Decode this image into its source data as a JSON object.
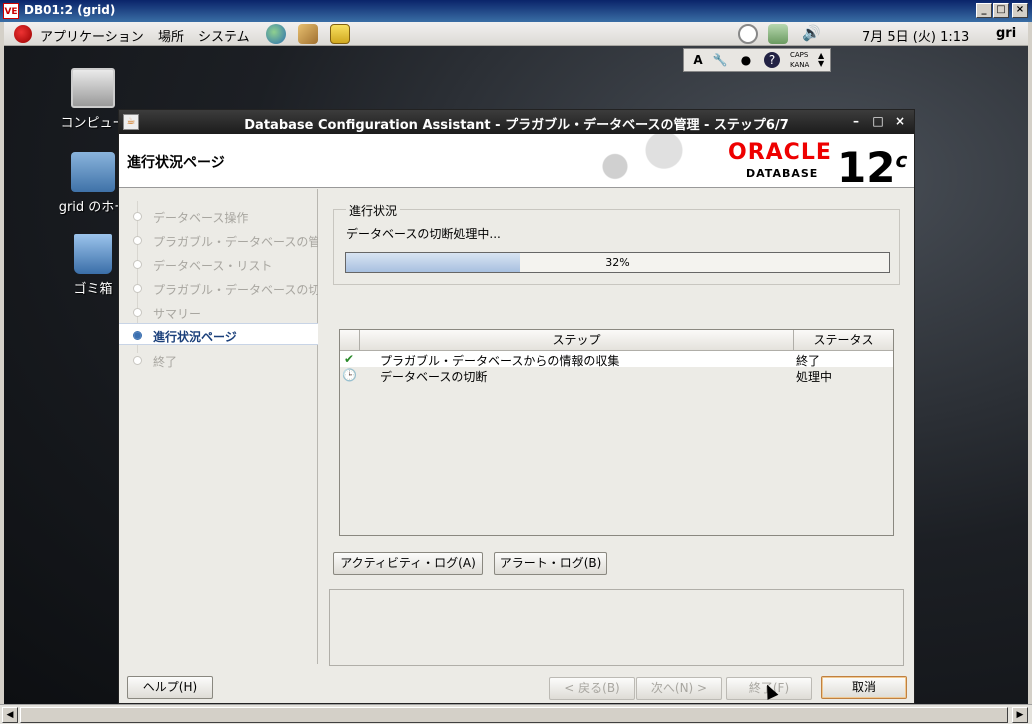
{
  "vnc": {
    "title": "DB01:2 (grid)",
    "icon_text": "VE"
  },
  "gnome_panel": {
    "menu_applications": "アプリケーション",
    "menu_places": "場所",
    "menu_system": "システム",
    "clock": "7月 5日 (火)  1:13",
    "user": "gri"
  },
  "ime": {
    "caps": "CAPS",
    "kana": "KANA"
  },
  "desktop": {
    "icons": [
      {
        "label": "コンピュー"
      },
      {
        "label": "grid のホー"
      },
      {
        "label": "ゴミ箱"
      }
    ]
  },
  "dbca": {
    "title": "Database Configuration Assistant - プラガブル・データベースの管理 - ステップ6/7",
    "page_title": "進行状況ページ",
    "brand": {
      "oracle": "ORACLE",
      "database": "DATABASE",
      "version": "12",
      "version_suffix": "c"
    },
    "nav": [
      {
        "label": "データベース操作",
        "active": false
      },
      {
        "label": "プラガブル・データベースの管",
        "active": false
      },
      {
        "label": "データベース・リスト",
        "active": false
      },
      {
        "label": "プラガブル・データベースの切",
        "active": false
      },
      {
        "label": "サマリー",
        "active": false
      },
      {
        "label": "進行状況ページ",
        "active": true
      },
      {
        "label": "終了",
        "active": false
      }
    ],
    "progress": {
      "legend": "進行状況",
      "message": "データベースの切断処理中...",
      "value": 0.32,
      "label": "32%"
    },
    "table": {
      "col_step": "ステップ",
      "col_status": "ステータス",
      "rows": [
        {
          "icon": "check-icon",
          "step": "プラガブル・データベースからの情報の収集",
          "status": "終了"
        },
        {
          "icon": "clock-icon",
          "step": "データベースの切断",
          "status": "処理中"
        }
      ]
    },
    "buttons": {
      "activity_log": "アクティビティ・ログ(A)",
      "alert_log": "アラート・ログ(B)",
      "help": "ヘルプ(H)",
      "back": "< 戻る(B)",
      "next": "次へ(N) >",
      "finish": "終了(F)",
      "cancel": "取消"
    }
  }
}
